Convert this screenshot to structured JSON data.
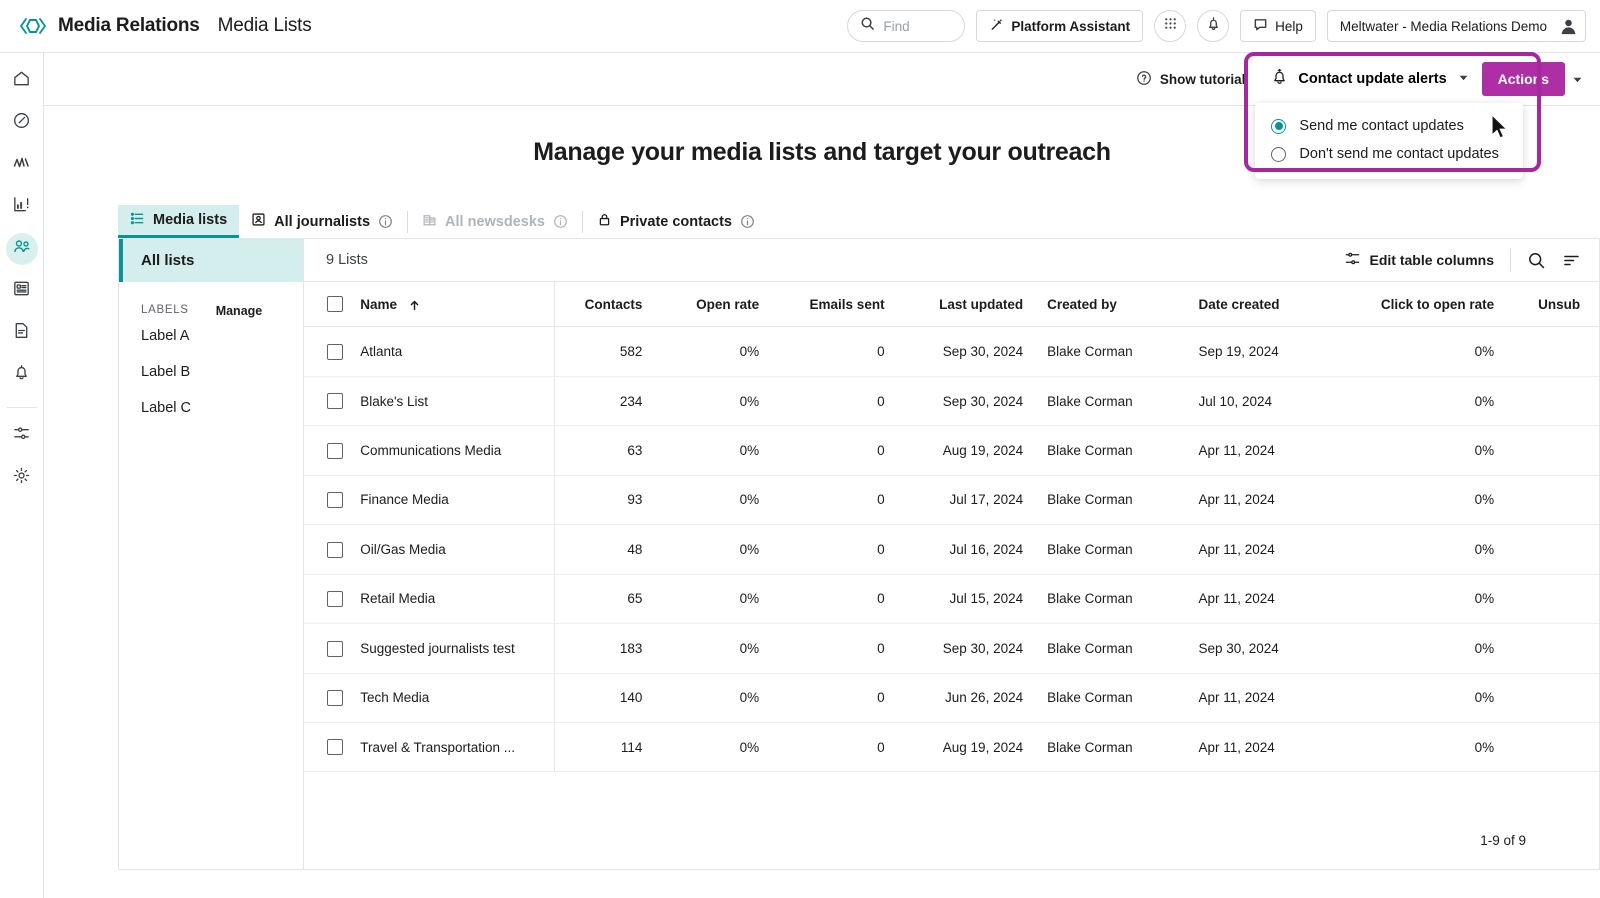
{
  "header": {
    "brand_title": "Media Relations",
    "brand_subtitle": "Media Lists",
    "logo_icon": "meltwater-logo-icon",
    "search": {
      "value": "",
      "placeholder": "Find",
      "icon": "search-icon"
    },
    "platform_assistant": {
      "label": "Platform Assistant",
      "icon": "magic-wand-icon"
    },
    "apps_icon": "grid-apps-icon",
    "notifications_icon": "bell-icon",
    "help": {
      "label": "Help",
      "icon": "chat-bubble-icon"
    },
    "account": {
      "label": "Meltwater - Media Relations Demo",
      "icon": "user-avatar-icon"
    }
  },
  "rail": {
    "items": [
      {
        "name": "home",
        "icon": "home-icon",
        "active": false
      },
      {
        "name": "explore",
        "icon": "compass-icon",
        "active": false
      },
      {
        "name": "pulse",
        "icon": "activity-icon",
        "active": false
      },
      {
        "name": "analytics",
        "icon": "bar-chart-alert-icon",
        "active": false
      },
      {
        "name": "contacts",
        "icon": "people-icon",
        "active": true
      },
      {
        "name": "newsroom",
        "icon": "article-card-icon",
        "active": false
      },
      {
        "name": "reports",
        "icon": "document-icon",
        "active": false
      },
      {
        "name": "alerts",
        "icon": "bell-outline-icon",
        "active": false
      },
      {
        "name": "preferences",
        "icon": "sliders-icon",
        "active": false
      },
      {
        "name": "settings",
        "icon": "gear-icon",
        "active": false
      }
    ]
  },
  "actionbar": {
    "show_tutorial": {
      "label": "Show tutorial",
      "icon": "question-circle-icon"
    },
    "contact_update_alerts": {
      "label": "Contact update alerts",
      "icon": "bell-plus-icon",
      "caret": "chevron-down-icon"
    },
    "actions_button": {
      "label": "Actions",
      "color": "#ad2ea5",
      "caret": "chevron-down-icon"
    },
    "alerts_menu": {
      "options": [
        {
          "label": "Send me contact updates",
          "selected": true
        },
        {
          "label": "Don't send me contact updates",
          "selected": false
        }
      ]
    },
    "highlight_color": "#a5289d"
  },
  "page_title": "Manage your media lists and target your outreach",
  "tabs": [
    {
      "label": "Media lists",
      "icon": "list-icon",
      "active": true,
      "disabled": false,
      "info": false
    },
    {
      "label": "All journalists",
      "icon": "journalist-id-icon",
      "active": false,
      "disabled": false,
      "info": true
    },
    {
      "label": "All newsdesks",
      "icon": "building-icon",
      "active": false,
      "disabled": true,
      "info": true
    },
    {
      "label": "Private contacts",
      "icon": "lock-icon",
      "active": false,
      "disabled": false,
      "info": true
    }
  ],
  "sidebar": {
    "all_lists": "All lists",
    "labels_header": "LABELS",
    "manage_label": "Manage",
    "labels": [
      "Label A",
      "Label B",
      "Label C"
    ]
  },
  "table": {
    "count_label": "9 Lists",
    "edit_columns_label": "Edit table columns",
    "edit_columns_icon": "sliders-icon",
    "search_icon": "search-icon",
    "sort_icon": "sort-icon",
    "select_all_checkbox": false,
    "sort_column": "Name",
    "sort_direction": "asc",
    "sort_icon_glyph": "arrow-up-icon",
    "columns": [
      "Name",
      "Contacts",
      "Open rate",
      "Emails sent",
      "Last updated",
      "Created by",
      "Date created",
      "Click to open rate",
      "Unsub"
    ],
    "rows": [
      {
        "name": "Atlanta",
        "contacts": "582",
        "open_rate": "0%",
        "emails_sent": "0",
        "last_updated": "Sep 30, 2024",
        "created_by": "Blake Corman",
        "date_created": "Sep 19, 2024",
        "click_to_open_rate": "0%",
        "unsub": ""
      },
      {
        "name": "Blake's List",
        "contacts": "234",
        "open_rate": "0%",
        "emails_sent": "0",
        "last_updated": "Sep 30, 2024",
        "created_by": "Blake Corman",
        "date_created": "Jul 10, 2024",
        "click_to_open_rate": "0%",
        "unsub": ""
      },
      {
        "name": "Communications Media",
        "contacts": "63",
        "open_rate": "0%",
        "emails_sent": "0",
        "last_updated": "Aug 19, 2024",
        "created_by": "Blake Corman",
        "date_created": "Apr 11, 2024",
        "click_to_open_rate": "0%",
        "unsub": ""
      },
      {
        "name": "Finance Media",
        "contacts": "93",
        "open_rate": "0%",
        "emails_sent": "0",
        "last_updated": "Jul 17, 2024",
        "created_by": "Blake Corman",
        "date_created": "Apr 11, 2024",
        "click_to_open_rate": "0%",
        "unsub": ""
      },
      {
        "name": "Oil/Gas Media",
        "contacts": "48",
        "open_rate": "0%",
        "emails_sent": "0",
        "last_updated": "Jul 16, 2024",
        "created_by": "Blake Corman",
        "date_created": "Apr 11, 2024",
        "click_to_open_rate": "0%",
        "unsub": ""
      },
      {
        "name": "Retail Media",
        "contacts": "65",
        "open_rate": "0%",
        "emails_sent": "0",
        "last_updated": "Jul 15, 2024",
        "created_by": "Blake Corman",
        "date_created": "Apr 11, 2024",
        "click_to_open_rate": "0%",
        "unsub": ""
      },
      {
        "name": "Suggested journalists test",
        "contacts": "183",
        "open_rate": "0%",
        "emails_sent": "0",
        "last_updated": "Sep 30, 2024",
        "created_by": "Blake Corman",
        "date_created": "Sep 30, 2024",
        "click_to_open_rate": "0%",
        "unsub": ""
      },
      {
        "name": "Tech Media",
        "contacts": "140",
        "open_rate": "0%",
        "emails_sent": "0",
        "last_updated": "Jun 26, 2024",
        "created_by": "Blake Corman",
        "date_created": "Apr 11, 2024",
        "click_to_open_rate": "0%",
        "unsub": ""
      },
      {
        "name": "Travel & Transportation ...",
        "contacts": "114",
        "open_rate": "0%",
        "emails_sent": "0",
        "last_updated": "Aug 19, 2024",
        "created_by": "Blake Corman",
        "date_created": "Apr 11, 2024",
        "click_to_open_rate": "0%",
        "unsub": ""
      }
    ],
    "pagination": "1-9 of 9"
  },
  "theme": {
    "accent_teal": "#0a9396",
    "accent_magenta": "#ad2ea5",
    "tab_active_bg": "#d3eeed"
  }
}
